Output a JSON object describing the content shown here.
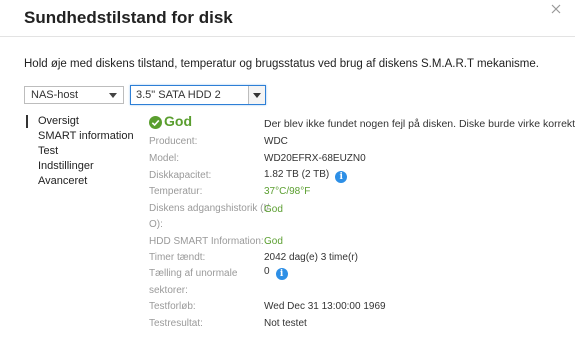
{
  "dialog": {
    "title": "Sundhedstilstand for disk",
    "description": "Hold øje med diskens tilstand, temperatur og brugsstatus ved brug af diskens S.M.A.R.T mekanisme."
  },
  "selectors": {
    "host": "NAS-host",
    "disk": "3.5\" SATA HDD 2"
  },
  "sidebar": {
    "items": [
      {
        "label": "Oversigt",
        "active": true
      },
      {
        "label": "SMART information",
        "active": false
      },
      {
        "label": "Test",
        "active": false
      },
      {
        "label": "Indstillinger",
        "active": false
      },
      {
        "label": "Avanceret",
        "active": false
      }
    ]
  },
  "status": {
    "label": "God",
    "message": "Der blev ikke fundet nogen fejl på disken. Diske burde virke korrekt."
  },
  "details": {
    "manufacturer_label": "Producent:",
    "manufacturer": "WDC",
    "model_label": "Model:",
    "model": "WD20EFRX-68EUZN0",
    "capacity_label": "Diskkapacitet:",
    "capacity": "1.82 TB (2 TB)",
    "temperature_label": "Temperatur:",
    "temperature": "37°C/98°F",
    "access_history_label_1": "Diskens adgangshistorik (I/",
    "access_history_label_2": "O):",
    "access_history": "God",
    "hdd_smart_label": "HDD SMART Information:",
    "hdd_smart": "God",
    "hours_label": "Timer tændt:",
    "hours": "2042 dag(e) 3 time(r)",
    "bad_sectors_label_1": "Tælling af unormale",
    "bad_sectors_label_2": "sektorer:",
    "bad_sectors": "0",
    "test_run_label": "Testforløb:",
    "test_run": "Wed Dec 31 13:00:00 1969",
    "test_result_label": "Testresultat:",
    "test_result": "Not testet"
  },
  "colors": {
    "accent": "#2d8fe6",
    "good": "#5a9e2f"
  },
  "icons": {
    "status": "check-circle-icon",
    "info": "info-icon",
    "close": "close-icon"
  }
}
